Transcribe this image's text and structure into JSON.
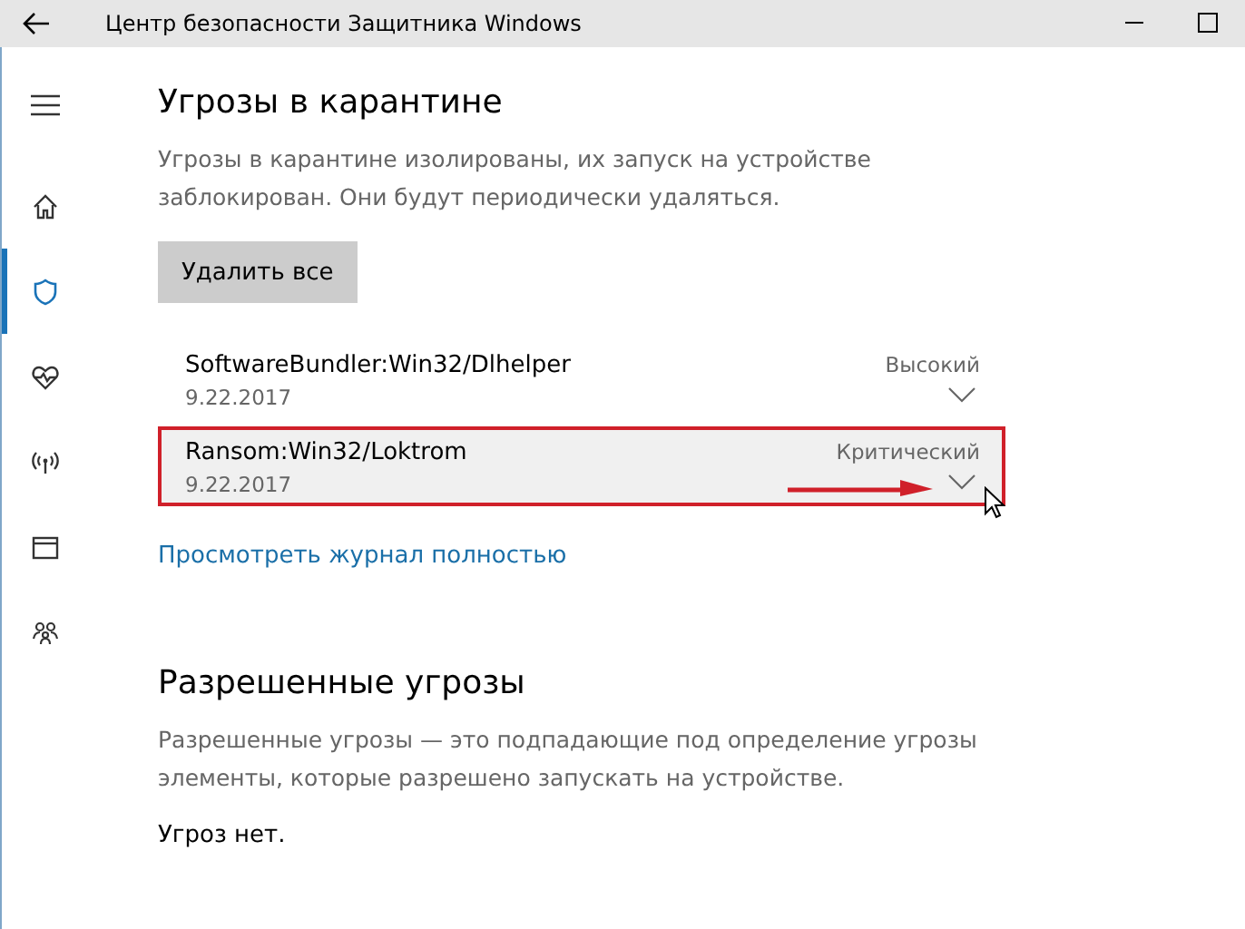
{
  "window": {
    "title": "Центр безопасности Защитника Windows"
  },
  "sidebar": {
    "items": [
      {
        "kind": "home",
        "selected": false
      },
      {
        "kind": "shield",
        "selected": true
      },
      {
        "kind": "heart",
        "selected": false
      },
      {
        "kind": "wireless",
        "selected": false
      },
      {
        "kind": "browser",
        "selected": false
      },
      {
        "kind": "family",
        "selected": false
      }
    ]
  },
  "quarantine": {
    "title": "Угрозы в карантине",
    "description": "Угрозы в карантине изолированы, их запуск на устройстве заблокирован. Они будут периодически удаляться.",
    "button": "Удалить все",
    "threats": [
      {
        "name": "SoftwareBundler:Win32/Dlhelper",
        "date": "9.22.2017",
        "severity": "Высокий",
        "selected": false,
        "annotated": false
      },
      {
        "name": "Ransom:Win32/Loktrom",
        "date": "9.22.2017",
        "severity": "Критический",
        "selected": true,
        "annotated": true
      }
    ],
    "link": "Просмотреть журнал полностью"
  },
  "allowed": {
    "title": "Разрешенные угрозы",
    "description": "Разрешенные угрозы — это подпадающие под определение угрозы элементы, которые разрешено запускать на устройстве.",
    "empty": "Угроз нет."
  }
}
